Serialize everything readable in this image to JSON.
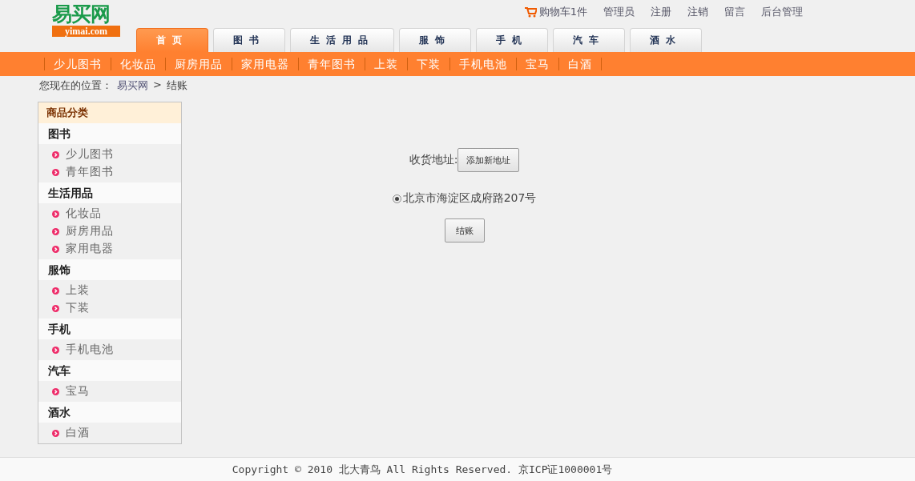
{
  "logo": {
    "name": "易买网",
    "domain": "yimai.com"
  },
  "top_links": [
    {
      "kind": "cart",
      "label": "购物车1件"
    },
    {
      "kind": "link",
      "label": "管理员"
    },
    {
      "kind": "link",
      "label": "注册"
    },
    {
      "kind": "link",
      "label": "注销"
    },
    {
      "kind": "link",
      "label": "留言"
    },
    {
      "kind": "link",
      "label": "后台管理"
    }
  ],
  "tabs": [
    {
      "label": "首页",
      "selected": true
    },
    {
      "label": "图书",
      "selected": false
    },
    {
      "label": "生活用品",
      "selected": false
    },
    {
      "label": "服饰",
      "selected": false
    },
    {
      "label": "手机",
      "selected": false
    },
    {
      "label": "汽车",
      "selected": false
    },
    {
      "label": "酒水",
      "selected": false
    }
  ],
  "subnav": [
    "少儿图书",
    "化妆品",
    "厨房用品",
    "家用电器",
    "青年图书",
    "上装",
    "下装",
    "手机电池",
    "宝马",
    "白酒"
  ],
  "breadcrumb": {
    "prefix": "您现在的位置：",
    "home": "易买网",
    "separator": ">",
    "current": "结账"
  },
  "sidebar": {
    "title": "商品分类",
    "groups": [
      {
        "name": "图书",
        "items": [
          "少儿图书",
          "青年图书"
        ]
      },
      {
        "name": "生活用品",
        "items": [
          "化妆品",
          "厨房用品",
          "家用电器"
        ]
      },
      {
        "name": "服饰",
        "items": [
          "上装",
          "下装"
        ]
      },
      {
        "name": "手机",
        "items": [
          "手机电池"
        ]
      },
      {
        "name": "汽车",
        "items": [
          "宝马"
        ]
      },
      {
        "name": "酒水",
        "items": [
          "白酒"
        ]
      }
    ]
  },
  "checkout": {
    "address_label": "收货地址:",
    "add_button": "添加新地址",
    "addresses": [
      {
        "label": "北京市海淀区成府路207号",
        "selected": true
      }
    ],
    "submit_button": "结账"
  },
  "footer": "Copyright © 2010 北大青鸟 All Rights Reserved. 京ICP证1000001号"
}
